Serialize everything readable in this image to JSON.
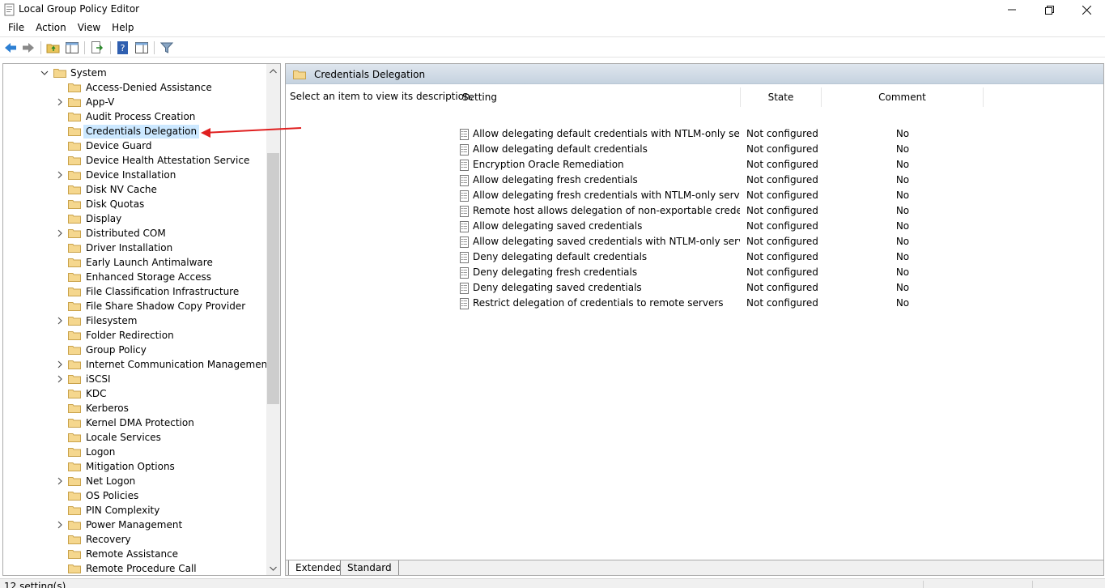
{
  "window": {
    "title": "Local Group Policy Editor",
    "minimize_icon": "minimize-icon",
    "maximize_icon": "restore-icon",
    "close_icon": "close-icon"
  },
  "menu": [
    "File",
    "Action",
    "View",
    "Help"
  ],
  "toolbar": [
    "back-icon",
    "forward-icon",
    "up-folder-icon",
    "show-hide-tree-icon",
    "export-list-icon",
    "help-icon",
    "properties-icon",
    "filter-icon"
  ],
  "tree": {
    "root": "System",
    "items": [
      {
        "label": "Access-Denied Assistance",
        "expandable": false
      },
      {
        "label": "App-V",
        "expandable": true
      },
      {
        "label": "Audit Process Creation",
        "expandable": false
      },
      {
        "label": "Credentials Delegation",
        "expandable": false,
        "selected": true
      },
      {
        "label": "Device Guard",
        "expandable": false
      },
      {
        "label": "Device Health Attestation Service",
        "expandable": false
      },
      {
        "label": "Device Installation",
        "expandable": true
      },
      {
        "label": "Disk NV Cache",
        "expandable": false
      },
      {
        "label": "Disk Quotas",
        "expandable": false
      },
      {
        "label": "Display",
        "expandable": false
      },
      {
        "label": "Distributed COM",
        "expandable": true
      },
      {
        "label": "Driver Installation",
        "expandable": false
      },
      {
        "label": "Early Launch Antimalware",
        "expandable": false
      },
      {
        "label": "Enhanced Storage Access",
        "expandable": false
      },
      {
        "label": "File Classification Infrastructure",
        "expandable": false
      },
      {
        "label": "File Share Shadow Copy Provider",
        "expandable": false
      },
      {
        "label": "Filesystem",
        "expandable": true
      },
      {
        "label": "Folder Redirection",
        "expandable": false
      },
      {
        "label": "Group Policy",
        "expandable": false
      },
      {
        "label": "Internet Communication Management",
        "expandable": true
      },
      {
        "label": "iSCSI",
        "expandable": true
      },
      {
        "label": "KDC",
        "expandable": false
      },
      {
        "label": "Kerberos",
        "expandable": false
      },
      {
        "label": "Kernel DMA Protection",
        "expandable": false
      },
      {
        "label": "Locale Services",
        "expandable": false
      },
      {
        "label": "Logon",
        "expandable": false
      },
      {
        "label": "Mitigation Options",
        "expandable": false
      },
      {
        "label": "Net Logon",
        "expandable": true
      },
      {
        "label": "OS Policies",
        "expandable": false
      },
      {
        "label": "PIN Complexity",
        "expandable": false
      },
      {
        "label": "Power Management",
        "expandable": true
      },
      {
        "label": "Recovery",
        "expandable": false
      },
      {
        "label": "Remote Assistance",
        "expandable": false
      },
      {
        "label": "Remote Procedure Call",
        "expandable": false
      }
    ]
  },
  "details": {
    "title": "Credentials Delegation",
    "description": "Select an item to view its description.",
    "columns": {
      "setting": "Setting",
      "state": "State",
      "comment": "Comment"
    },
    "rows": [
      {
        "setting": "Allow delegating default credentials with NTLM-only server ...",
        "state": "Not configured",
        "comment": "No"
      },
      {
        "setting": "Allow delegating default credentials",
        "state": "Not configured",
        "comment": "No"
      },
      {
        "setting": "Encryption Oracle Remediation",
        "state": "Not configured",
        "comment": "No"
      },
      {
        "setting": "Allow delegating fresh credentials",
        "state": "Not configured",
        "comment": "No"
      },
      {
        "setting": "Allow delegating fresh credentials with NTLM-only server au...",
        "state": "Not configured",
        "comment": "No"
      },
      {
        "setting": "Remote host allows delegation of non-exportable credentials",
        "state": "Not configured",
        "comment": "No"
      },
      {
        "setting": "Allow delegating saved credentials",
        "state": "Not configured",
        "comment": "No"
      },
      {
        "setting": "Allow delegating saved credentials with NTLM-only server a...",
        "state": "Not configured",
        "comment": "No"
      },
      {
        "setting": "Deny delegating default credentials",
        "state": "Not configured",
        "comment": "No"
      },
      {
        "setting": "Deny delegating fresh credentials",
        "state": "Not configured",
        "comment": "No"
      },
      {
        "setting": "Deny delegating saved credentials",
        "state": "Not configured",
        "comment": "No"
      },
      {
        "setting": "Restrict delegation of credentials to remote servers",
        "state": "Not configured",
        "comment": "No"
      }
    ]
  },
  "tabs": [
    "Extended",
    "Standard"
  ],
  "status": "12 setting(s)",
  "colors": {
    "selection": "#cce8ff",
    "header_band": "#c5d2df",
    "annotation_arrow": "#e02020",
    "folder": "#f5d78e"
  }
}
